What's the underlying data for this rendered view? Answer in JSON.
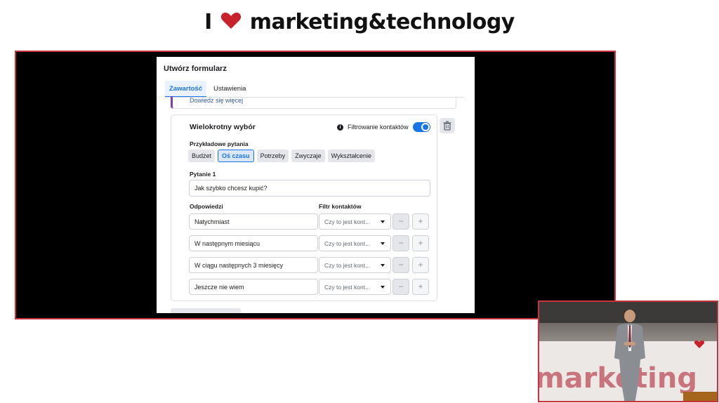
{
  "logo": {
    "prefix": "I",
    "suffix": "marketing&technology",
    "heart_color": "#c8232c"
  },
  "dialog": {
    "title": "Utwórz formularz",
    "tabs": [
      {
        "label": "Zawartość",
        "active": true
      },
      {
        "label": "Ustawienia",
        "active": false
      }
    ],
    "learn_more": "Dowiedz się więcej",
    "card": {
      "title": "Wielokrotny wybór",
      "filter_label": "Filtrowanie kontaktów",
      "filter_on": true,
      "sample_label": "Przykładowe pytania",
      "chips": [
        {
          "label": "Budżet",
          "active": false
        },
        {
          "label": "Oś czasu",
          "active": true
        },
        {
          "label": "Potrzeby",
          "active": false
        },
        {
          "label": "Zwyczaje",
          "active": false
        },
        {
          "label": "Wykształcenie",
          "active": false
        }
      ],
      "question_label": "Pytanie 1",
      "question_value": "Jak szybko chcesz kupić?",
      "answers_label": "Odpowiedzi",
      "contact_filter_label": "Filtr kontaktów",
      "answers": [
        {
          "value": "Natychmiast",
          "filter": "Czy to jest kont..."
        },
        {
          "value": "W następnym miesiącu",
          "filter": "Czy to jest kont..."
        },
        {
          "value": "W ciągu następnych 3 miesięcy",
          "filter": "Czy to jest kont..."
        },
        {
          "value": "Jeszcze nie wiem",
          "filter": "Czy to jest kont..."
        }
      ],
      "minus_symbol": "−",
      "plus_symbol": "+"
    }
  },
  "video": {
    "banner_text": "marketing"
  },
  "colors": {
    "accent": "#1b74e4",
    "frame_border": "#c8323c"
  }
}
